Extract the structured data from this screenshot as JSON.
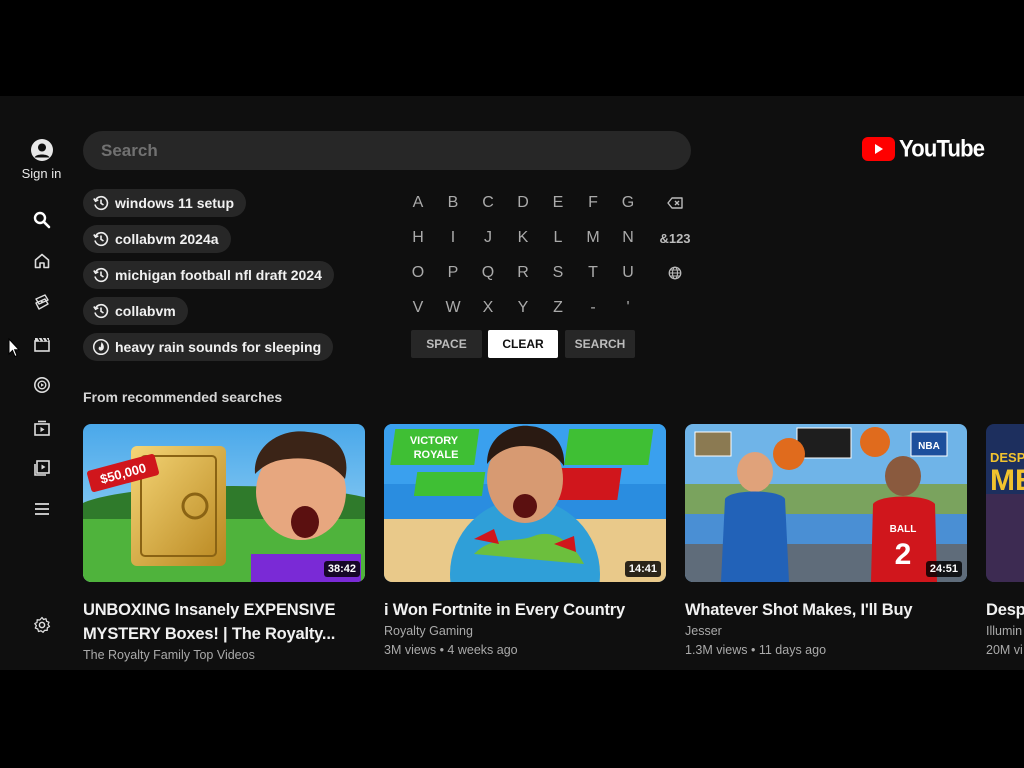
{
  "brand": {
    "name": "YouTube",
    "accent": "#ff0000"
  },
  "sidebar": {
    "signin_label": "Sign in",
    "items": [
      {
        "name": "search-icon"
      },
      {
        "name": "home-icon"
      },
      {
        "name": "shorts-icon"
      },
      {
        "name": "clapperboard-icon"
      },
      {
        "name": "music-icon"
      },
      {
        "name": "gaming-icon"
      },
      {
        "name": "playlist-icon"
      },
      {
        "name": "menu-icon"
      },
      {
        "name": "gear-icon"
      }
    ]
  },
  "search": {
    "placeholder": "Search"
  },
  "suggestions": [
    {
      "label": "windows 11 setup",
      "icon": "history-icon"
    },
    {
      "label": "collabvm 2024a",
      "icon": "history-icon"
    },
    {
      "label": "michigan football nfl draft 2024",
      "icon": "history-icon"
    },
    {
      "label": "collabvm",
      "icon": "history-icon"
    },
    {
      "label": "heavy rain sounds for sleeping",
      "icon": "trending-icon"
    }
  ],
  "keyboard": {
    "rows": [
      [
        "A",
        "B",
        "C",
        "D",
        "E",
        "F",
        "G"
      ],
      [
        "H",
        "I",
        "J",
        "K",
        "L",
        "M",
        "N"
      ],
      [
        "O",
        "P",
        "Q",
        "R",
        "S",
        "T",
        "U"
      ],
      [
        "V",
        "W",
        "X",
        "Y",
        "Z",
        "-",
        "'"
      ]
    ],
    "side_keys": {
      "backspace": "backspace-icon",
      "symbols": "&123",
      "language": "globe-icon"
    },
    "space_label": "SPACE",
    "clear_label": "CLEAR",
    "search_label": "SEARCH",
    "focused": "CLEAR"
  },
  "recommended": {
    "title": "From recommended searches",
    "videos": [
      {
        "title": "UNBOXING Insanely EXPENSIVE MYSTERY Boxes! | The Royalty...",
        "channel": "The Royalty Family Top Videos",
        "meta": "",
        "duration": "38:42",
        "thumb_text": "$50,000"
      },
      {
        "title": "i Won Fortnite in Every Country",
        "channel": "Royalty Gaming",
        "meta": "3M views • 4 weeks ago",
        "duration": "14:41",
        "thumb_text": "VICTORY ROYALE"
      },
      {
        "title": "Whatever Shot Makes, I'll Buy",
        "channel": "Jesser",
        "meta": "1.3M views • 11 days ago",
        "duration": "24:51",
        "thumb_text": "BALL"
      },
      {
        "title": "Desp",
        "channel": "Illumin",
        "meta": "20M vi",
        "duration": "",
        "thumb_text": "DESPICA ME"
      }
    ]
  }
}
